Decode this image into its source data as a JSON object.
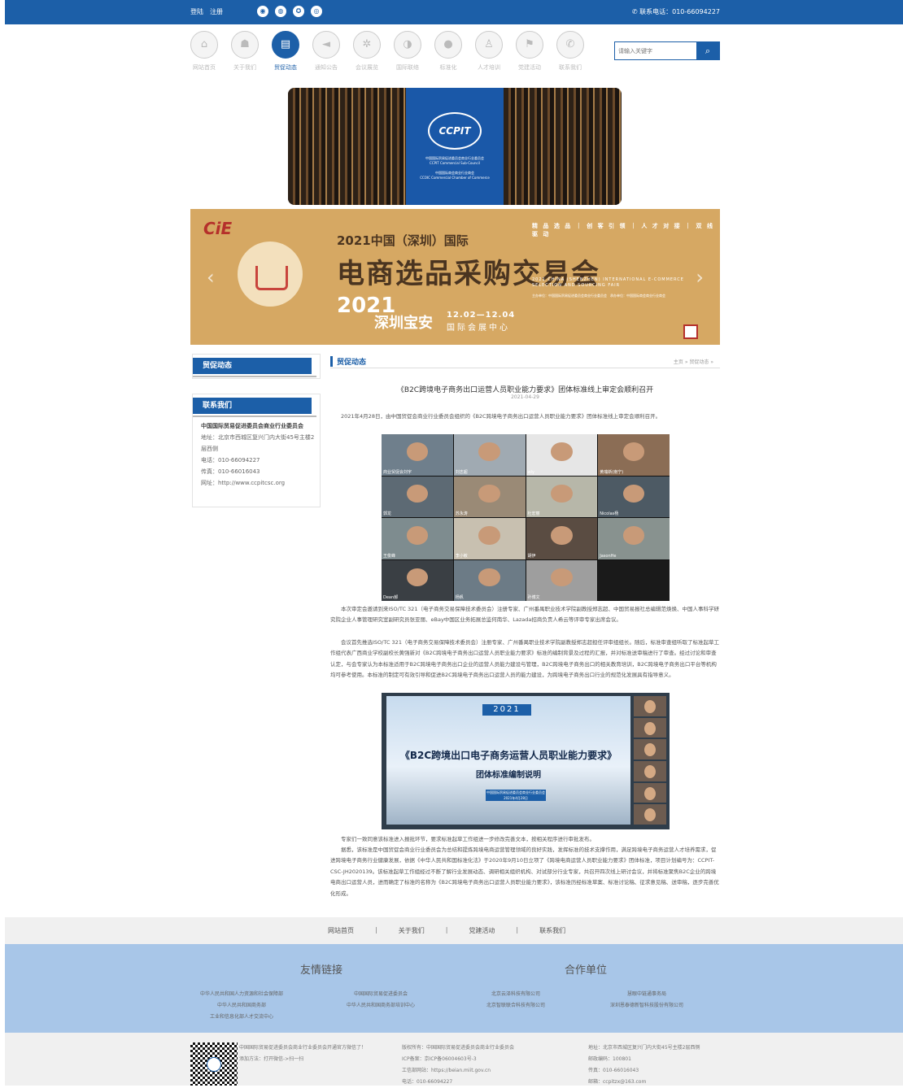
{
  "topbar": {
    "login": "登陆",
    "register": "注册",
    "phone": "联系电话：010-66094227",
    "social_icons": [
      "weibo-icon",
      "qq-icon",
      "wechat-icon",
      "mail-icon"
    ]
  },
  "nav": [
    {
      "label": "网站首页",
      "icon": "home-icon"
    },
    {
      "label": "关于我们",
      "icon": "people-icon"
    },
    {
      "label": "贸促动态",
      "icon": "news-icon",
      "active": true
    },
    {
      "label": "通知公告",
      "icon": "speaker-icon"
    },
    {
      "label": "会议展览",
      "icon": "gear-icon"
    },
    {
      "label": "国际联络",
      "icon": "globe-icon"
    },
    {
      "label": "标准化",
      "icon": "chat-icon"
    },
    {
      "label": "人才培训",
      "icon": "person-icon"
    },
    {
      "label": "党建活动",
      "icon": "flag-icon"
    },
    {
      "label": "联系我们",
      "icon": "phone-icon"
    }
  ],
  "search": {
    "placeholder": "请输入关键字"
  },
  "banner1": {
    "logo": "CCPIT",
    "line1": "中国国际贸易促进委员会商业行业委员会",
    "line2": "CCPIT Commercial Sub-Council",
    "line3": "中国国际商会商业行业商会",
    "line4": "CCOIC Commercial Chamber of Commerce"
  },
  "banner2": {
    "brand": "CiE",
    "title1": "2021中国（深圳）国际",
    "title2": "电商选品采购交易会",
    "year": "2021",
    "city": "深圳宝安",
    "dates": "12.02—12.04",
    "venue": "国际会展中心",
    "tags": "精 品 选 品 ｜ 创 客 引 领 ｜ 人 才 对 接 ｜ 双 线 驱 动",
    "english": "2021 CHINA (SHENZHEN) INTERNATIONAL E-COMMERCE SELECTION AND SOURCING FAIR",
    "info": "主办单位：中国国际贸易促进委员会商业行业委员会　承办单位：中国国际商会商业行业商会"
  },
  "sidebar": {
    "news_title": "贸促动态",
    "contact_title": "联系我们",
    "org": "中国国际贸易促进委员会商业行业委员会",
    "address": "地址：北京市西城区复兴门内大街45号主楼2层西侧",
    "tel": "电话：010-66094227",
    "fax": "传真：010-66016043",
    "web": "网址：http://www.ccpitcsc.org"
  },
  "main": {
    "heading": "贸促动态",
    "breadcrumb": "主页 » 贸促动态 »",
    "title": "《B2C跨境电子商务出口运营人员职业能力要求》团体标准线上审定会顺利召开",
    "date": "2021-04-29",
    "p1": "2021年4月28日，由中国贸促会商业行业委员会组织的《B2C跨境电子商务出口运营人员职业能力要求》团体标准线上审定会顺利召开。",
    "p2": "本次审定会邀请到来ISO/TC 321（电子商务交易保障技术委员会）注册专家、广州番禺职业技术学院副教授郑志超、中国贸易报社总编辑范焕焕、中国人事科学研究院企业人事管理研究室副研究员张亚丽、eBay中国区业务拓展总监何南华、Lazada招商负责人希云等评审专家出席会议。",
    "p3": "会议首先推选ISO/TC 321（电子商务交易保障技术委员会）注册专家、广州番禺职业技术学院副教授郑志超担任评审组组长。随后，标准审查组听取了标准起草工作组代表广西商业学校副校长黄强新对《B2C跨境电子商务出口运营人员职业能力要求》标准的编制背景及过程的汇报，并对标准送审稿进行了审查。经过讨论和审查认定，与会专家认为本标准适用于B2C跨境电子商务出口企业的运营人员能力建设与管理，B2C跨境电子商务出口的相关教育培训，B2C跨境电子商务出口平台等机构均可参考使用。本标准的制定可有效引导和促进B2C跨境电子商务出口运营人员的能力建设，为跨境电子商务出口行业的规范化发展具有指导意义。",
    "p4": "专家们一致同意该标准进入报批环节，要求标准起草工作组进一步修改完善文本，按相关程序进行审批发布。",
    "p5": "据悉，该标准是中国贸促会商业行业委员会为总结和提炼跨境电商运营管理领域的良好实践，发挥标准的技术支撑作用，满足跨境电子商务运营人才培养需求，促进跨境电子商务行业健康发展，依据《中华人民共和国标准化法》于2020年9月10日立项了《跨境电商运营人员职业能力要求》团体标准，项目计划编号为：CCPIT-CSC-JH2020139。该标准起草工作组经过不断了解行业发展动态、调研相关组织机构、对试部分行业专家，共召开四次线上研讨会议，并将标准聚焦B2C企业的跨境电商出口运营人员，进而确定了标准的名称为《B2C跨境电子商务出口运营人员职业能力要求》，该标准历经标准草案、标准讨论稿、征求意见稿、送审稿，逐步完善优化形成。",
    "video_names": [
      "商业贸促会刘宇",
      "刘志超",
      "wly",
      "黄瑞新(南宁)",
      "郭龙",
      "苏永涛",
      "杜宏丽",
      "Nicolas杨",
      "王俊峰",
      "李小敏",
      "胡伊",
      "JasonHe",
      "Dean郝",
      "杨帆",
      "孙博文",
      ""
    ],
    "slide_year": "2021",
    "slide_title": "《B2C跨境出口电子商务运营人员职业能力要求》",
    "slide_sub": "团体标准编制说明",
    "slide_org": "中国国际贸易促进委员会商业行业委员会 2021年4月28日"
  },
  "footer": {
    "links": [
      "网站首页",
      "关于我们",
      "党建活动",
      "联系我们"
    ],
    "friends_title": "友情链接",
    "partners_title": "合作单位",
    "friends_col1": [
      "中华人民共和国人力资源和社会保障部",
      "中华人民共和国商务部",
      "工业和信息化部人才交流中心"
    ],
    "friends_col2": [
      "中国国际贸易促进委员会",
      "中华人民共和国商务部培训中心"
    ],
    "partners_col1": [
      "北京云泽科技有限公司",
      "北京智联联合科技有限公司"
    ],
    "partners_col2": [
      "慧眼中链通事务局",
      "深圳恩泰德新智科技股份有限公司"
    ],
    "qr_text1": "中国国际贸易促进委员会商业行业委员会开通官方微信了！",
    "qr_text2": "添加方法：打开微信->扫一扫",
    "copyright": "版权所有：中国国际贸易促进委员会商业行业委员会",
    "icp": "ICP备案：京ICP备06004603号-3",
    "miit": "工信部网站：https://beian.miit.gov.cn",
    "ftel": "电话：010-66094227",
    "faddr": "地址：北京市西城区复兴门内大街45号主楼2层西侧",
    "postcode": "邮政编码：100801",
    "ffax": "传真：010-66016043",
    "email": "邮箱：ccpitzx@163.com"
  }
}
